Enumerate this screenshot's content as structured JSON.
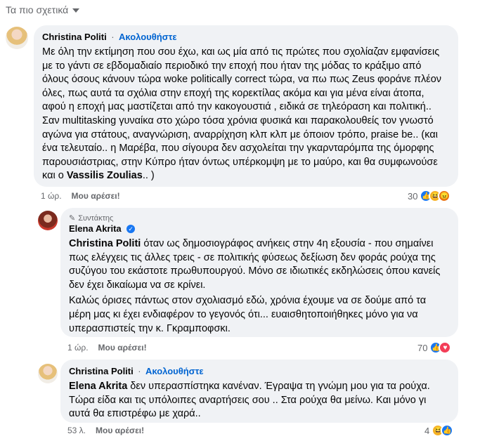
{
  "header": {
    "sort_label": "Τα πιο σχετικά"
  },
  "comments": [
    {
      "author": "Christina Politi",
      "follow": "Ακολουθήστε",
      "text_before": "Με όλη την εκτίμηση που σου έχω, και ως μία από τις πρώτες που σχολίαζαν εμφανίσεις με το γάντι σε εβδομαδιαίο περιοδικό την εποχή που ήταν της μόδας το κράξιμο από όλους όσους κάνουν τώρα woke politically correct τώρα, να πω πως Zeus φοράνε πλέον όλες, πως αυτά τα σχόλια στην εποχή της κορεκτίλας ακόμα και για μένα είναι άτοπα, αφού η εποχή μας μαστίζεται από την κακογουστιά , ειδικά σε τηλεόραση και πολιτική.. Σαν multitasking γυναίκα στο χώρο τόσα χρόνια φυσικά και παρακολουθείς τον γνωστό αγώνα για στάτους, αναγνώριση, αναρρίχηση κλπ κλπ με όποιον τρόπο, praise be.. (και ένα τελευταίο.. η Μαρέβα, που σίγουρα δεν ασχολείται την γκαρνταρόμπα της όμορφης παρουσιάστριας, στην Κύπρο ήταν όντως υπέρκομψη με το μαύρο, και θα συμφωνούσε και ο ",
      "mention": "Vassilis Zoulias",
      "text_after": ".. )",
      "time": "1 ώρ.",
      "like_label": "Μου αρέσει!",
      "reaction_count": "30"
    },
    {
      "badge": "Συντάκτης",
      "author": "Elena Akrita",
      "mention": "Christina Politi",
      "text": " όταν ως δημοσιογράφος ανήκεις στην 4η εξουσία - που σημαίνει πως ελέγχεις τις άλλες τρεις - σε πολιτικής φύσεως δεξίωση δεν φοράς ρούχα της συζύγου του εκάστοτε πρωθυπουργού. Μόνο σε ιδιωτικές εκδηλώσεις όπου κανείς δεν έχει δικαίωμα να σε κρίνει.",
      "text2": "Καλώς όρισες πάντως στον σχολιασμό εδώ, χρόνια έχουμε να σε δούμε από τα μέρη μας κι έχει ενδιαφέρον το γεγονός ότι... ευαισθητοποιήθηκες μόνο για να υπερασπιστείς την κ. Γκραμποφσκι.",
      "time": "1 ώρ.",
      "like_label": "Μου αρέσει!",
      "reaction_count": "70"
    },
    {
      "author": "Christina Politi",
      "follow": "Ακολουθήστε",
      "mention": "Elena Akrita",
      "text": " δεν υπερασπίστηκα κανέναν. Έγραψα τη γνώμη μου για τα ρούχα. Τώρα είδα και τις υπόλοιπες αναρτήσεις σου .. Στα ρούχα θα μείνω. Και μόνο γι αυτά θα επιστρέφω με χαρά..",
      "time": "53 λ.",
      "like_label": "Μου αρέσει!",
      "reaction_count": "4"
    }
  ]
}
